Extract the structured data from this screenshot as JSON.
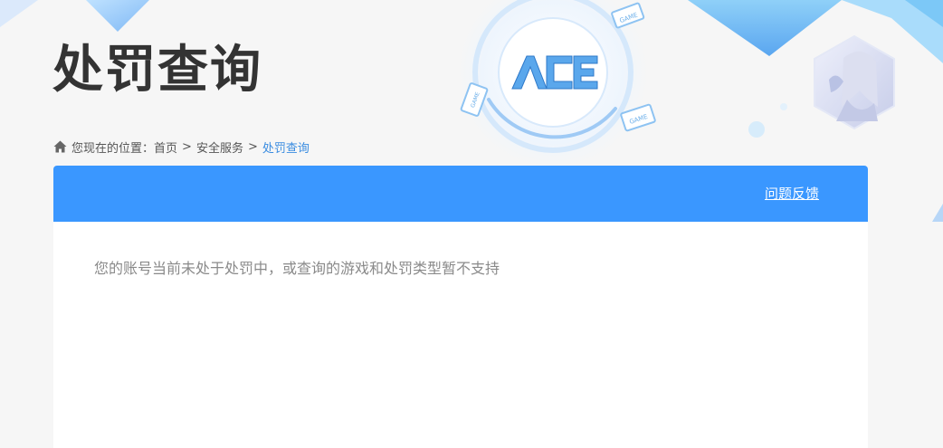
{
  "page": {
    "title": "处罚查询"
  },
  "logo": {
    "text": "ACE",
    "badges": [
      "GAME",
      "GAME",
      "GAME"
    ]
  },
  "breadcrumb": {
    "prefix": "您现在的位置：",
    "items": [
      "首页",
      "安全服务"
    ],
    "separator": ">",
    "current": "处罚查询"
  },
  "panel": {
    "feedback_label": "问题反馈",
    "message": "您的账号当前未处于处罚中，或查询的游戏和处罚类型暂不支持"
  },
  "colors": {
    "header_blue": "#3a97ff",
    "current_crumb": "#3a8ce0",
    "title": "#333333",
    "message": "#8a8a8a",
    "background": "#f6f6f6"
  },
  "icons": [
    "home-icon",
    "ace-logo",
    "game-badge-icon",
    "character-avatar"
  ]
}
